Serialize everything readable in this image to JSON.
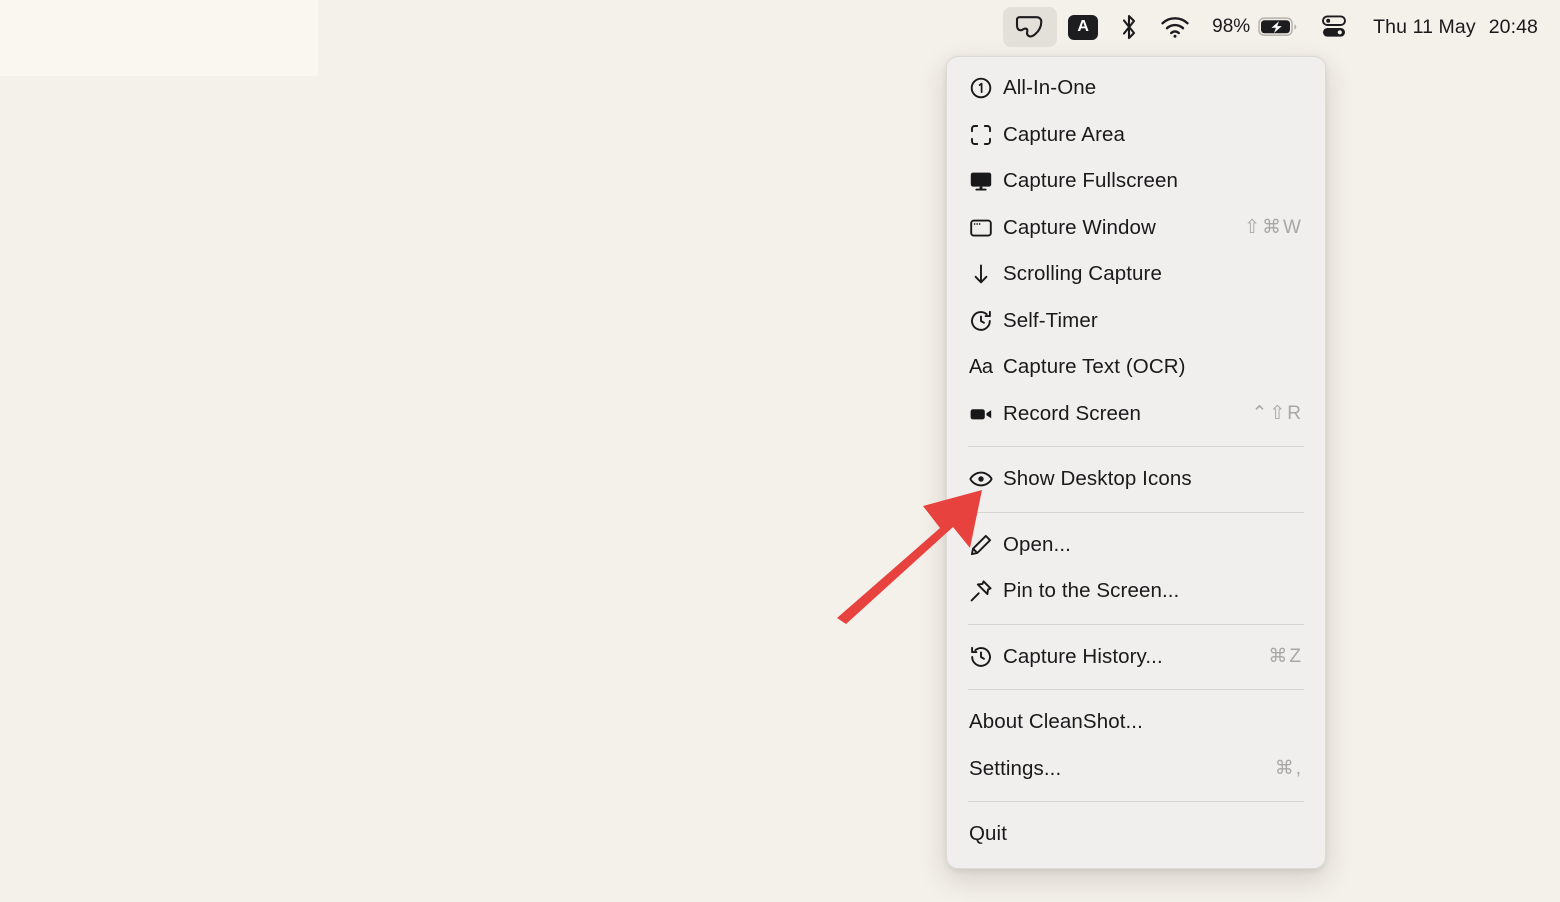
{
  "menubar": {
    "items": [
      {
        "name": "cleanshot-menubar-icon",
        "label": "CleanShot",
        "active": true
      },
      {
        "name": "input-source-indicator",
        "label": "A",
        "active": false
      },
      {
        "name": "bluetooth-icon",
        "label": "Bluetooth",
        "active": false
      },
      {
        "name": "wifi-icon",
        "label": "Wi-Fi",
        "active": false
      }
    ],
    "battery_percent": "98%",
    "battery_charging": true,
    "control_center_label": "Control Center",
    "clock_date": "Thu 11 May",
    "clock_time": "20:48"
  },
  "menu": {
    "app_name": "CleanShot",
    "groups": [
      {
        "items": [
          {
            "icon": "all-in-one-icon",
            "label": "All-In-One",
            "shortcut": ""
          },
          {
            "icon": "capture-area-icon",
            "label": "Capture Area",
            "shortcut": ""
          },
          {
            "icon": "capture-fullscreen-icon",
            "label": "Capture Fullscreen",
            "shortcut": ""
          },
          {
            "icon": "capture-window-icon",
            "label": "Capture Window",
            "shortcut": "⇧⌘W"
          },
          {
            "icon": "scrolling-capture-icon",
            "label": "Scrolling Capture",
            "shortcut": ""
          },
          {
            "icon": "self-timer-icon",
            "label": "Self-Timer",
            "shortcut": ""
          },
          {
            "icon": "capture-text-ocr-icon",
            "label": "Capture Text (OCR)",
            "shortcut": ""
          },
          {
            "icon": "record-screen-icon",
            "label": "Record Screen",
            "shortcut": "⌃⇧R"
          }
        ]
      },
      {
        "items": [
          {
            "icon": "eye-icon",
            "label": "Show Desktop Icons",
            "shortcut": ""
          }
        ]
      },
      {
        "items": [
          {
            "icon": "pencil-icon",
            "label": "Open...",
            "shortcut": ""
          },
          {
            "icon": "pin-icon",
            "label": "Pin to the Screen...",
            "shortcut": ""
          }
        ]
      },
      {
        "items": [
          {
            "icon": "history-icon",
            "label": "Capture History...",
            "shortcut": "⌘Z"
          }
        ]
      },
      {
        "items": [
          {
            "icon": "",
            "label": "About CleanShot...",
            "shortcut": ""
          },
          {
            "icon": "",
            "label": "Settings...",
            "shortcut": "⌘,"
          }
        ]
      },
      {
        "items": [
          {
            "icon": "",
            "label": "Quit",
            "shortcut": ""
          }
        ]
      }
    ]
  },
  "annotation": {
    "name": "red-arrow-annotation",
    "color": "#e8423f",
    "points_at": "Show Desktop Icons"
  },
  "colors": {
    "desktop_background": "#f4f0ea",
    "menubar_strip": "#faf7f1",
    "menu_background": "#f0efed",
    "text": "#1a1a1c",
    "shortcut_text": "#a9a7a3",
    "separator": "#d8d6d2",
    "accent_red": "#e8423f"
  }
}
